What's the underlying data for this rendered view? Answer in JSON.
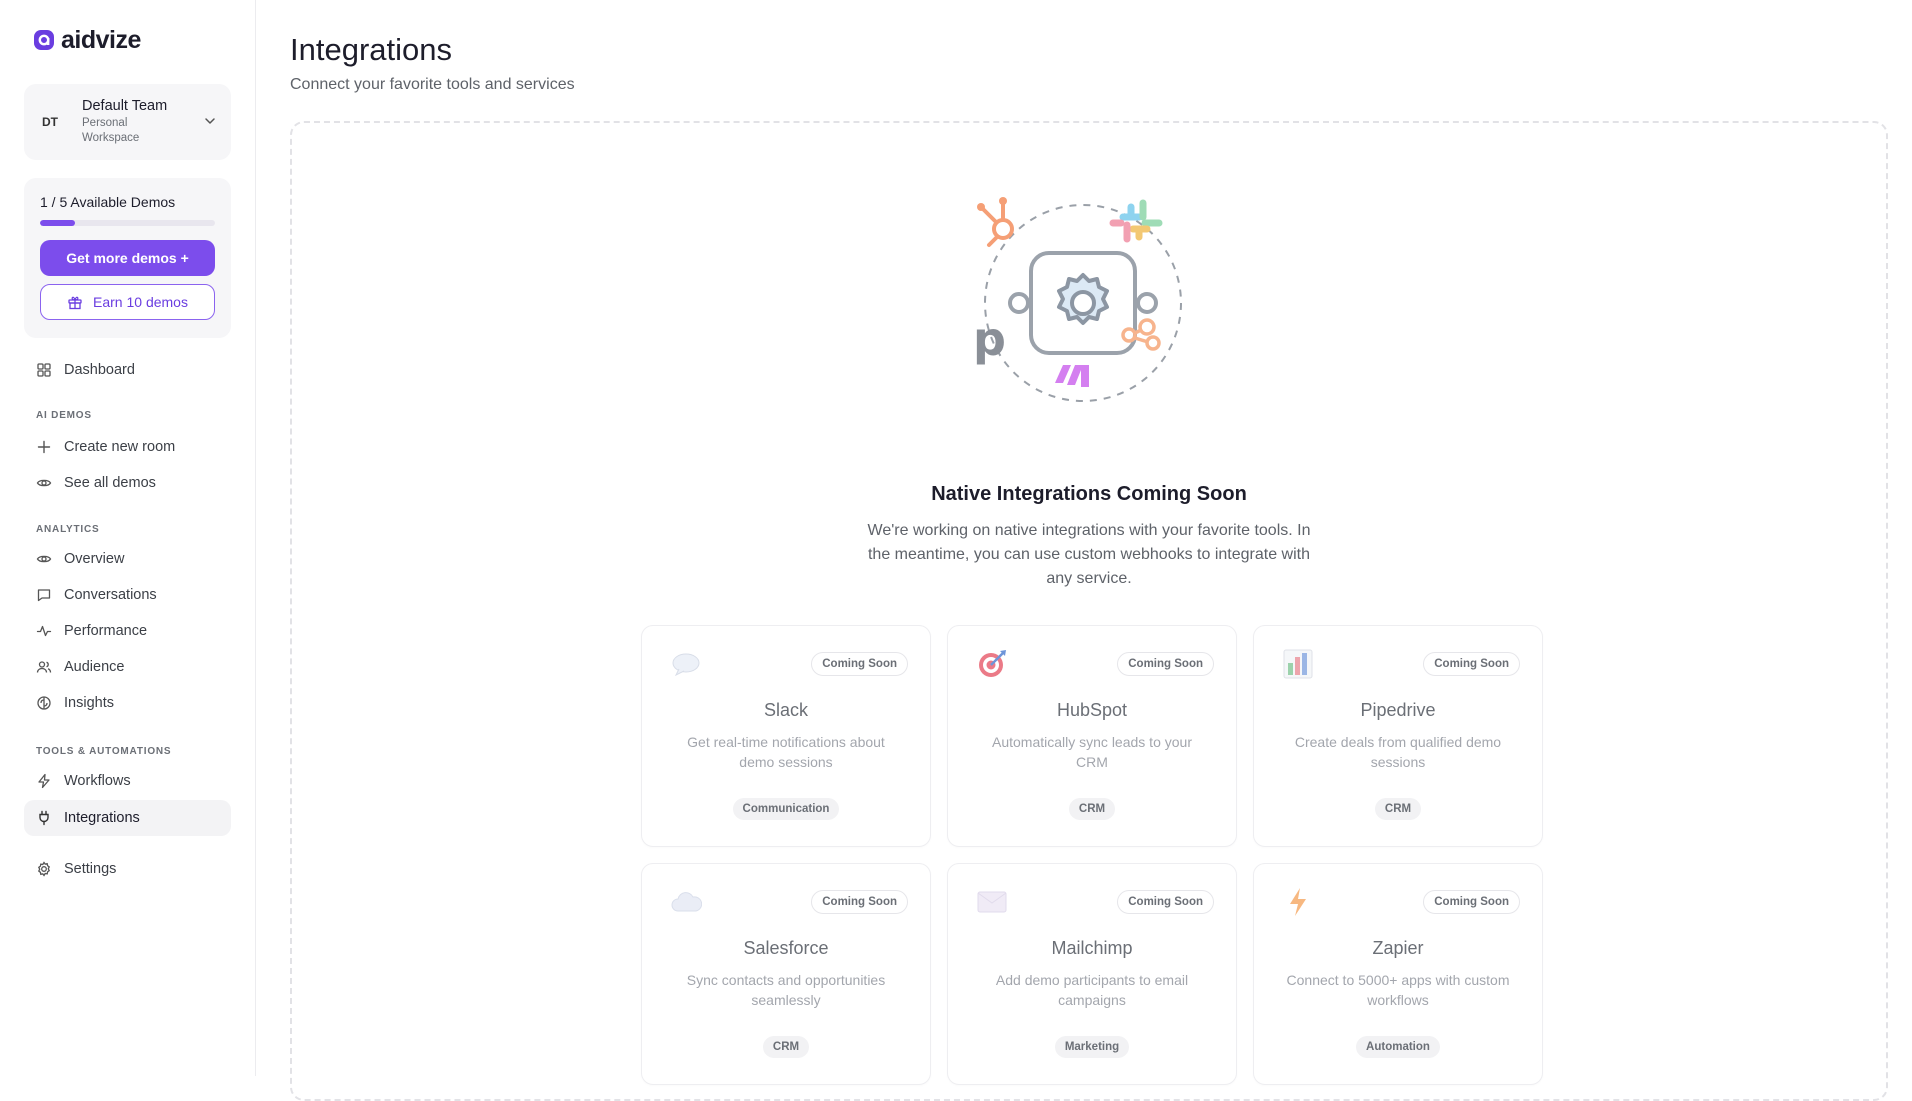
{
  "brand": {
    "name": "aidvize"
  },
  "team": {
    "initials": "DT",
    "name": "Default Team",
    "subtitle": "Personal Workspace"
  },
  "demos": {
    "count_label": "1 / 5 Available Demos",
    "used": 1,
    "total": 5,
    "get_more_label": "Get more demos +",
    "earn_label": "Earn 10 demos"
  },
  "nav": {
    "dashboard": "Dashboard",
    "sections": {
      "ai_demos": "AI DEMOS",
      "analytics": "ANALYTICS",
      "tools": "TOOLS & AUTOMATIONS"
    },
    "ai_demos": [
      {
        "label": "Create new room",
        "icon": "plus-icon"
      },
      {
        "label": "See all demos",
        "icon": "eye-icon"
      }
    ],
    "analytics": [
      {
        "label": "Overview",
        "icon": "eye-icon"
      },
      {
        "label": "Conversations",
        "icon": "chat-icon"
      },
      {
        "label": "Performance",
        "icon": "activity-icon"
      },
      {
        "label": "Audience",
        "icon": "users-icon"
      },
      {
        "label": "Insights",
        "icon": "brain-icon"
      }
    ],
    "tools": [
      {
        "label": "Workflows",
        "icon": "bolt-icon"
      },
      {
        "label": "Integrations",
        "icon": "plug-icon",
        "active": true
      }
    ],
    "settings": "Settings"
  },
  "page": {
    "title": "Integrations",
    "subtitle": "Connect your favorite tools and services"
  },
  "empty_state": {
    "title": "Native Integrations Coming Soon",
    "description": "We're working on native integrations with your favorite tools. In the meantime, you can use custom webhooks to integrate with any service."
  },
  "integrations": [
    {
      "name": "Slack",
      "badge": "Coming Soon",
      "description": "Get real-time notifications about demo sessions",
      "tag": "Communication",
      "icon": "speech-bubble-icon"
    },
    {
      "name": "HubSpot",
      "badge": "Coming Soon",
      "description": "Automatically sync leads to your CRM",
      "tag": "CRM",
      "icon": "target-icon"
    },
    {
      "name": "Pipedrive",
      "badge": "Coming Soon",
      "description": "Create deals from qualified demo sessions",
      "tag": "CRM",
      "icon": "bar-chart-icon"
    },
    {
      "name": "Salesforce",
      "badge": "Coming Soon",
      "description": "Sync contacts and opportunities seamlessly",
      "tag": "CRM",
      "icon": "cloud-icon"
    },
    {
      "name": "Mailchimp",
      "badge": "Coming Soon",
      "description": "Add demo participants to email campaigns",
      "tag": "Marketing",
      "icon": "envelope-icon"
    },
    {
      "name": "Zapier",
      "badge": "Coming Soon",
      "description": "Connect to 5000+ apps with custom workflows",
      "tag": "Automation",
      "icon": "lightning-icon"
    }
  ],
  "colors": {
    "accent": "#7c4dec",
    "accent_dark": "#6a3de0"
  }
}
